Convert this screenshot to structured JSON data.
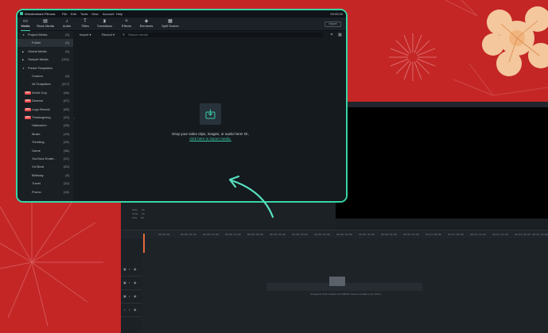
{
  "colors": {
    "background": "#c42626",
    "accent": "#3bc9a5",
    "highlight_border": "#38d4a6",
    "hot_badge": "#ef4d4d"
  },
  "front_window": {
    "title": "Wondershare Filmora",
    "menu": [
      "File",
      "Edit",
      "Tools",
      "View",
      "Account",
      "Help"
    ],
    "time": "00:00:00",
    "tabs": [
      {
        "label": "Media",
        "icon": "folder-icon",
        "active": true
      },
      {
        "label": "Stock Media",
        "icon": "stock-media-icon",
        "active": false
      },
      {
        "label": "Audio",
        "icon": "music-note-icon",
        "active": false
      },
      {
        "label": "Titles",
        "icon": "text-icon",
        "active": false
      },
      {
        "label": "Transitions",
        "icon": "transition-icon",
        "active": false
      },
      {
        "label": "Effects",
        "icon": "effects-icon",
        "active": false
      },
      {
        "label": "Elements",
        "icon": "elements-icon",
        "active": false
      },
      {
        "label": "Split Screen",
        "icon": "split-screen-icon",
        "active": false
      }
    ],
    "export_label": "Export",
    "sidebar": [
      {
        "label": "Project Media",
        "count": "(0)",
        "arrow": "▼",
        "indent": 0,
        "selected": false,
        "hot": false
      },
      {
        "label": "Folder",
        "count": "(0)",
        "arrow": "",
        "indent": 1,
        "selected": true,
        "hot": false
      },
      {
        "label": "Global Media",
        "count": "(0)",
        "arrow": "▶",
        "indent": 0,
        "selected": false,
        "hot": false
      },
      {
        "label": "Sample Media",
        "count": "(101)",
        "arrow": "▶",
        "indent": 0,
        "selected": false,
        "hot": false
      },
      {
        "label": "Preset Templates",
        "count": "",
        "arrow": "▼",
        "indent": 0,
        "selected": false,
        "hot": false
      },
      {
        "label": "Custom",
        "count": "(0)",
        "arrow": "",
        "indent": 1,
        "selected": false,
        "hot": false
      },
      {
        "label": "All Templates",
        "count": "(317)",
        "arrow": "",
        "indent": 1,
        "selected": false,
        "hot": false
      },
      {
        "label": "World Cup",
        "count": "(6x)",
        "arrow": "",
        "indent": 1,
        "selected": false,
        "hot": true
      },
      {
        "label": "Diwesm",
        "count": "(07)",
        "arrow": "",
        "indent": 1,
        "selected": false,
        "hot": true
      },
      {
        "label": "Logo Reveal",
        "count": "(09)",
        "arrow": "",
        "indent": 1,
        "selected": false,
        "hot": true
      },
      {
        "label": "Thanksgiving",
        "count": "(20)",
        "arrow": "",
        "indent": 1,
        "selected": false,
        "hot": true
      },
      {
        "label": "Halloween",
        "count": "(33)",
        "arrow": "",
        "indent": 1,
        "selected": false,
        "hot": false
      },
      {
        "label": "Music",
        "count": "(19)",
        "arrow": "",
        "indent": 1,
        "selected": false,
        "hot": false
      },
      {
        "label": "Trending",
        "count": "(32)",
        "arrow": "",
        "indent": 1,
        "selected": false,
        "hot": false
      },
      {
        "label": "Game",
        "count": "(36)",
        "arrow": "",
        "indent": 1,
        "selected": false,
        "hot": false
      },
      {
        "label": "YouTube Ender...",
        "count": "(37)",
        "arrow": "",
        "indent": 1,
        "selected": false,
        "hot": false
      },
      {
        "label": "Vol Beat",
        "count": "(20)",
        "arrow": "",
        "indent": 1,
        "selected": false,
        "hot": false
      },
      {
        "label": "Birthday",
        "count": "(9)",
        "arrow": "",
        "indent": 1,
        "selected": false,
        "hot": false
      },
      {
        "label": "Travel",
        "count": "(22)",
        "arrow": "",
        "indent": 1,
        "selected": false,
        "hot": false
      },
      {
        "label": "Promo",
        "count": "(16)",
        "arrow": "",
        "indent": 1,
        "selected": false,
        "hot": false
      }
    ],
    "hot_badge_label": "HOT",
    "filters": {
      "import_label": "Import",
      "record_label": "Record"
    },
    "search_placeholder": "Search media",
    "drop_message": "Drop your video clips, images, or audio here! Or,",
    "drop_link": "click here to import media."
  },
  "back_window": {
    "info_rows": [
      {
        "label": "Date",
        "value": "00"
      },
      {
        "label": "Time",
        "value": "00"
      },
      {
        "label": "Size",
        "value": "00"
      }
    ],
    "ruler_ticks": [
      "00:00:00",
      "00:00:05:00",
      "00:00:10:00",
      "00:00:15:00",
      "00:00:20:00",
      "00:00:25:00",
      "00:00:30:00",
      "00:00:35:00",
      "00:00:40:00",
      "00:00:45:00",
      "00:00:50:00",
      "00:00:55:00",
      "00:01:00:00",
      "00:01:05:00",
      "00:01:10:00",
      "00:01:15:00",
      "00:01:20:00",
      "00:01:25:00"
    ],
    "timeline_hint": "Drag and drop media and effects here to create your video."
  }
}
